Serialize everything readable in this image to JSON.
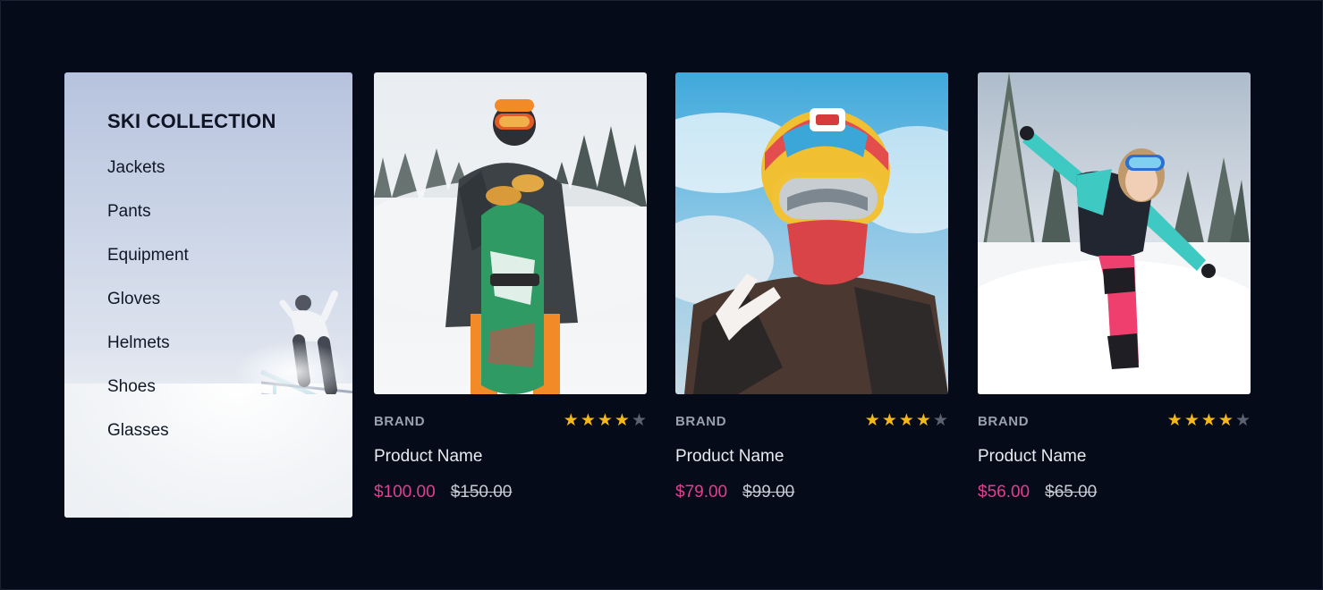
{
  "sidebar": {
    "title": "SKI COLLECTION",
    "items": [
      {
        "label": "Jackets"
      },
      {
        "label": "Pants"
      },
      {
        "label": "Equipment"
      },
      {
        "label": "Gloves"
      },
      {
        "label": "Helmets"
      },
      {
        "label": "Shoes"
      },
      {
        "label": "Glasses"
      }
    ]
  },
  "products": [
    {
      "brand": "BRAND",
      "name": "Product Name",
      "price": "$100.00",
      "old_price": "$150.00",
      "rating": 4,
      "max_rating": 5,
      "image": "snowboarder-with-board"
    },
    {
      "brand": "BRAND",
      "name": "Product Name",
      "price": "$79.00",
      "old_price": "$99.00",
      "rating": 4,
      "max_rating": 5,
      "image": "helmet-selfie-peace-sign"
    },
    {
      "brand": "BRAND",
      "name": "Product Name",
      "price": "$56.00",
      "old_price": "$65.00",
      "rating": 4,
      "max_rating": 5,
      "image": "skier-in-snow"
    }
  ],
  "colors": {
    "background": "#050b18",
    "price_accent": "#e0408f",
    "star_filled": "#f5b81b",
    "star_empty": "#5c6370"
  }
}
